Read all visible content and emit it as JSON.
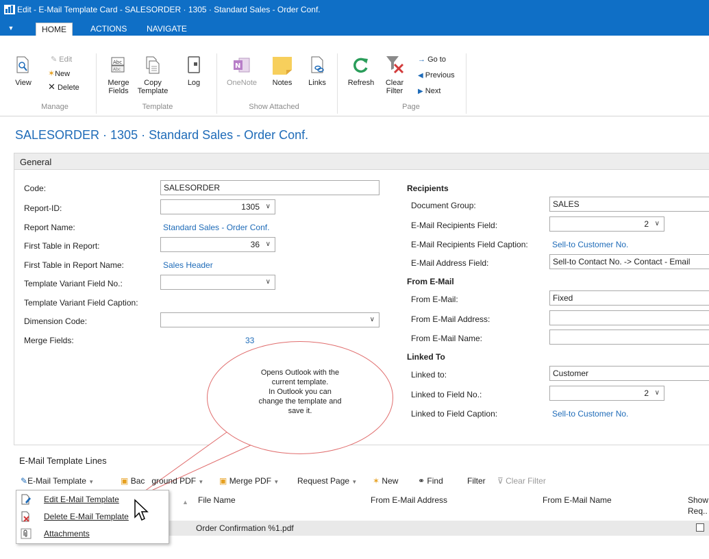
{
  "window": {
    "title": "Edit - E-Mail Template Card - SALESORDER · 1305 · Standard Sales - Order Conf."
  },
  "tabs": [
    {
      "label": "▼"
    },
    {
      "label": "HOME"
    },
    {
      "label": "ACTIONS"
    },
    {
      "label": "NAVIGATE"
    }
  ],
  "ribbon": {
    "manage": {
      "view": "View",
      "edit": "Edit",
      "new": "New",
      "delete": "Delete",
      "group": "Manage"
    },
    "template": {
      "merge_line1": "Merge",
      "merge_line2": "Fields",
      "copy_line1": "Copy",
      "copy_line2": "Template",
      "log": "Log",
      "group": "Template"
    },
    "attached": {
      "onenote": "OneNote",
      "notes": "Notes",
      "links": "Links",
      "group": "Show Attached"
    },
    "page": {
      "refresh": "Refresh",
      "clear_line1": "Clear",
      "clear_line2": "Filter",
      "goto": "Go to",
      "previous": "Previous",
      "next": "Next",
      "group": "Page"
    }
  },
  "page_title": "SALESORDER · 1305 · Standard Sales - Order Conf.",
  "general": {
    "header": "General",
    "code_label": "Code:",
    "code_value": "SALESORDER",
    "report_id_label": "Report-ID:",
    "report_id_value": "1305",
    "report_name_label": "Report Name:",
    "report_name_value": "Standard Sales - Order Conf.",
    "first_table_label": "First Table in Report:",
    "first_table_value": "36",
    "first_table_name_label": "First Table in Report Name:",
    "first_table_name_value": "Sales Header",
    "variant_field_label": "Template Variant Field No.:",
    "variant_field_value": "",
    "variant_caption_label": "Template Variant Field Caption:",
    "dimension_label": "Dimension Code:",
    "dimension_value": "",
    "merge_fields_label": "Merge Fields:",
    "merge_fields_value": "33",
    "recipients_header": "Recipients",
    "doc_group_label": "Document Group:",
    "doc_group_value": "SALES",
    "recip_field_label": "E-Mail Recipients Field:",
    "recip_field_value": "2",
    "recip_caption_label": "E-Mail Recipients Field Caption:",
    "recip_caption_value": "Sell-to Customer No.",
    "addr_field_label": "E-Mail Address Field:",
    "addr_field_value": "Sell-to Contact No. -> Contact - Email",
    "from_header": "From E-Mail",
    "from_label": "From E-Mail:",
    "from_value": "Fixed",
    "from_addr_label": "From E-Mail Address:",
    "from_addr_value": "",
    "from_name_label": "From E-Mail Name:",
    "from_name_value": "",
    "linked_header": "Linked To",
    "linked_to_label": "Linked to:",
    "linked_to_value": "Customer",
    "linked_field_label": "Linked to Field No.:",
    "linked_field_value": "2",
    "linked_caption_label": "Linked to Field Caption:",
    "linked_caption_value": "Sell-to Customer No."
  },
  "callout": {
    "line1": "Opens Outlook with the",
    "line2": "current template.",
    "line3": "In Outlook you can",
    "line4": "change the template and",
    "line5": "save it."
  },
  "lines": {
    "header": "E-Mail Template Lines",
    "toolbar": {
      "email_template": "E-Mail Template",
      "background_pdf_part1": "Bac",
      "background_pdf_part2": "ground PDF",
      "merge_pdf": "Merge PDF",
      "request_page": "Request Page",
      "new": "New",
      "find": "Find",
      "filter": "Filter",
      "clear_filter": "Clear Filter"
    },
    "columns": {
      "file_name": "File Name",
      "from_address": "From E-Mail Address",
      "from_name": "From E-Mail Name",
      "show_line1": "Show",
      "show_line2": "Req.."
    },
    "rows": [
      {
        "file_name": "Order Confirmation %1.pdf"
      }
    ]
  },
  "popup_menu": {
    "items": [
      {
        "label": "Edit E-Mail Template"
      },
      {
        "label": "Delete E-Mail Template"
      },
      {
        "label": "Attachments"
      }
    ]
  }
}
